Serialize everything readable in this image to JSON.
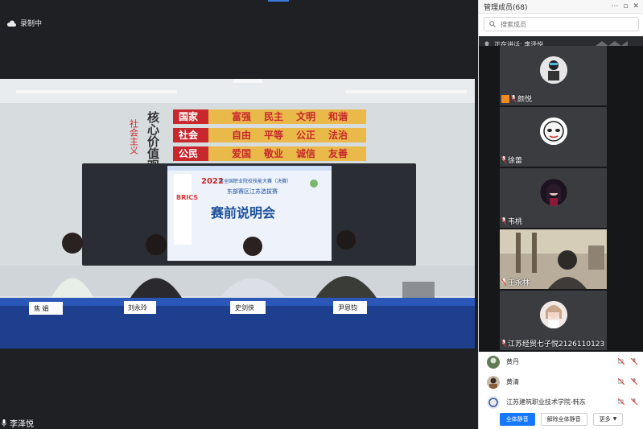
{
  "recording": {
    "label": "录制中"
  },
  "main_speaker": {
    "name": "李泽悦"
  },
  "panel": {
    "title": "管理成员(68)",
    "search_placeholder": "搜索成员",
    "speaking_label": "正在讲话: 李泽悦"
  },
  "tiles": [
    {
      "name": "颜悦"
    },
    {
      "name": "徐蕾"
    },
    {
      "name": "韦桃"
    },
    {
      "name": "王永林"
    },
    {
      "name": "江苏经贸七子悦2126110123"
    }
  ],
  "members": [
    {
      "name": "黄丹"
    },
    {
      "name": "黄清"
    },
    {
      "name": "江苏建筑职业技术学院-韩东"
    }
  ],
  "buttons": {
    "mute_all": "全体静音",
    "unmute_all": "解除全体静音",
    "more": "更多"
  },
  "scene": {
    "banner_words": [
      "国家",
      "富强",
      "民主",
      "文明",
      "和谐",
      "社会",
      "自由",
      "平等",
      "公正",
      "法治",
      "公民",
      "爱国",
      "敬业",
      "诚信",
      "友善"
    ],
    "slogan_left": "社会主义",
    "slogan_right": "核心价值观",
    "screen_year": "2022",
    "screen_heading": "年全国职业院校技能大赛（决赛）",
    "screen_sub": "东部赛区江苏选拔赛",
    "screen_title": "赛前说明会",
    "placards": [
      "焦 娟",
      "刘永玲",
      "史剑侠",
      "尹恩钧"
    ]
  },
  "colors": {
    "accent": "#1677ff",
    "banner_red": "#c8282d",
    "banner_gold": "#e9b94a"
  }
}
